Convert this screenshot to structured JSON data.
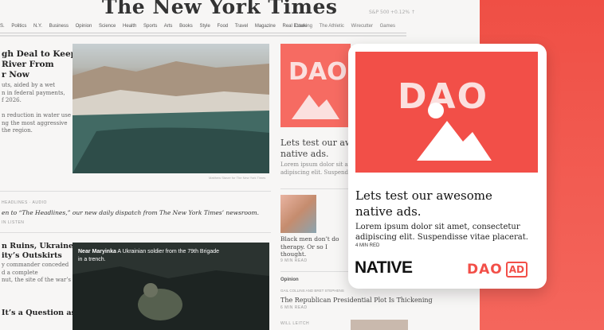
{
  "page": {
    "masthead": "The New York Times",
    "meta_left": "S&P 500",
    "meta_right": "+0.12% ↑",
    "nav_items": [
      "S.",
      "Politics",
      "N.Y.",
      "Business",
      "Opinion",
      "Science",
      "Health",
      "Sports",
      "Arts",
      "Books",
      "Style",
      "Food",
      "Travel",
      "Magazine",
      "Real Estate"
    ],
    "nav_right_items": [
      "Cooking",
      "The Athletic",
      "Wirecutter",
      "Games"
    ],
    "headline_1": "gh Deal to Keep\nRiver From\nr Now",
    "summary_1": "uts, aided by a wet\nn in federal payments,\nf 2026.\n\nn reduction in water use\nng the most aggressive\nthe region.",
    "photo_caption": "Matthew Staver for The New York Times",
    "headlines_tag": "HEADLINES · AUDIO",
    "dispatch": "en to “The Headlines,” our new daily dispatch from The New York Times’ newsroom.",
    "dispatch_meta": "IN LISTEN",
    "headline_2": "n Ruins, Ukraine\nity’s Outskirts",
    "summary_2": "y commander conceded\nd a complete\nnut, the site of the war’s",
    "headline_3": "It’s a Question as Old",
    "photo2_caption_bold": "Near Maryinka",
    "photo2_caption_rest": " A Ukrainian soldier from the 79th Brigade\nin a trench.",
    "mini_title": "Lets test our awesome\nnative ads.",
    "mini_body": "Lorem ipsum dolor sit amet, co\nadipiscing elit. Suspendisse v",
    "mini_h": "Black men don’t do\ntherapy. Or so I\nthought.",
    "mini_h_meta": "9 MIN READ",
    "opinion_label": "Opinion",
    "byline": "GAIL COLLINS AND BRET STEPHENS",
    "rep_headline": "The Republican Presidential Plot Is Thickening",
    "rep_meta": "6 MIN READ",
    "bottom_byline": "WILL LEITCH"
  },
  "card": {
    "logo": "DAO",
    "title": "Lets test our awesome\nnative ads.",
    "body": "Lorem ipsum dolor sit amet, consectetur\nadipiscing elit. Suspendisse vitae placerat.",
    "read_time": "4 MIN RED",
    "native_label": "NATIVE",
    "badge_logo": "DAO",
    "badge_ad": "AD"
  },
  "colors": {
    "brand_red": "#f24f48",
    "background_coral": "#ef4f45",
    "card_bg": "#ffffff"
  }
}
